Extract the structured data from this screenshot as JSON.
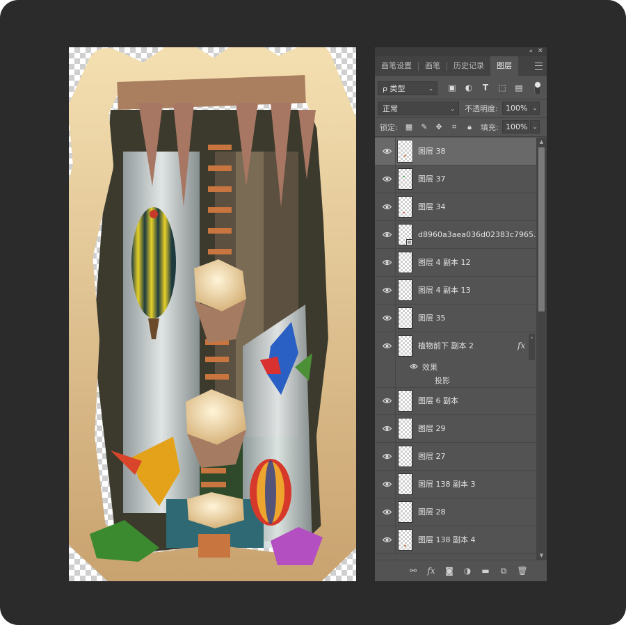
{
  "panel": {
    "collapse_icon": "«",
    "close_icon": "✕",
    "tabs": [
      {
        "label": "画笔设置",
        "active": false
      },
      {
        "label": "画笔",
        "active": false
      },
      {
        "label": "历史记录",
        "active": false
      },
      {
        "label": "图层",
        "active": true
      }
    ],
    "filter": {
      "kind_label": "ρ 类型",
      "icons": [
        "image-filter-icon",
        "adjustment-filter-icon",
        "type-filter-icon",
        "shape-filter-icon",
        "smart-object-filter-icon"
      ]
    },
    "blend_mode": "正常",
    "opacity": {
      "label": "不透明度:",
      "value": "100%"
    },
    "lock": {
      "label": "锁定:"
    },
    "fill": {
      "label": "填充:",
      "value": "100%"
    },
    "layers": [
      {
        "name": "图层 38",
        "selected": true
      },
      {
        "name": "图层 37",
        "selected": false
      },
      {
        "name": "图层 34",
        "selected": false
      },
      {
        "name": "d8960a3aea036d02383c7965...",
        "selected": false,
        "smart": true
      },
      {
        "name": "图层 4 副本 12",
        "selected": false
      },
      {
        "name": "图层 4 副本 13",
        "selected": false
      },
      {
        "name": "图层 35",
        "selected": false
      },
      {
        "name": "植物前下 副本 2",
        "selected": false,
        "fx": "fx"
      },
      {
        "name": "图层 6 副本",
        "selected": false
      },
      {
        "name": "图层 29",
        "selected": false
      },
      {
        "name": "图层 27",
        "selected": false
      },
      {
        "name": "图层 138 副本 3",
        "selected": false
      },
      {
        "name": "图层 28",
        "selected": false
      },
      {
        "name": "图层 138 副本 4",
        "selected": false
      }
    ],
    "effects": {
      "label": "效果",
      "item": "投影"
    },
    "bottom_icons": [
      "link-icon",
      "fx-icon",
      "mask-icon",
      "adjustment-icon",
      "folder-icon",
      "new-layer-icon",
      "trash-icon"
    ]
  },
  "colors": {
    "background": "#2b2b2b",
    "panel": "#535353",
    "selected_row": "#696969"
  }
}
